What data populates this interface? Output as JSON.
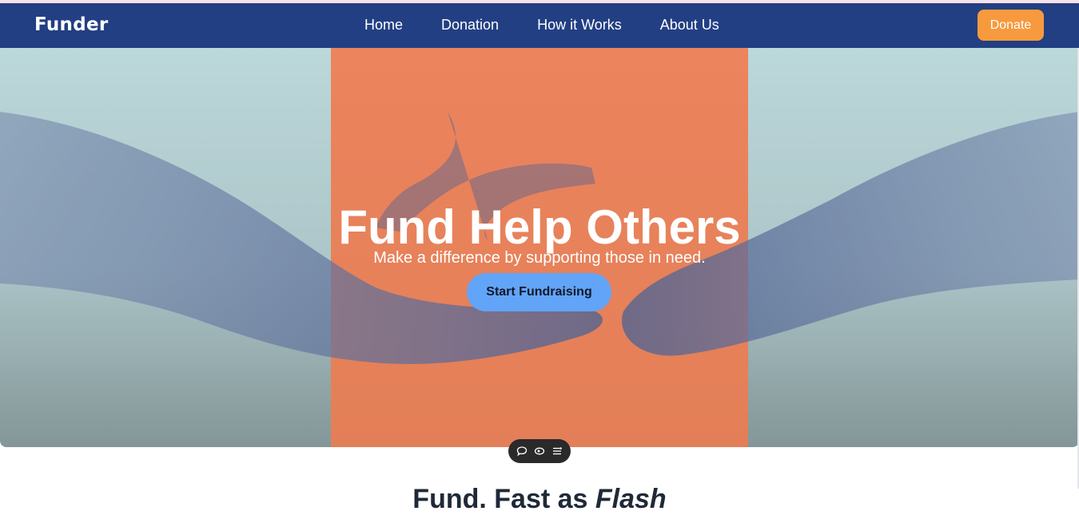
{
  "brand": {
    "name": "Funder"
  },
  "nav": {
    "items": [
      {
        "label": "Home"
      },
      {
        "label": "Donation"
      },
      {
        "label": "How it Works"
      },
      {
        "label": "About Us"
      }
    ],
    "donate_label": "Donate"
  },
  "hero": {
    "title": "Fund Help Others",
    "subtitle": "Make a difference by supporting those in need.",
    "cta_label": "Start Fundraising"
  },
  "toolbar": {
    "icons": [
      "comment-icon",
      "eye-icon",
      "list-settings-icon"
    ]
  },
  "section": {
    "title_prefix": "Fund. Fast as ",
    "title_emphasis": "Flash"
  },
  "colors": {
    "navbar": "#223f83",
    "donate_button": "#f79a3d",
    "cta_button": "#62a4f7",
    "hero_panel": "#ec7f57"
  }
}
